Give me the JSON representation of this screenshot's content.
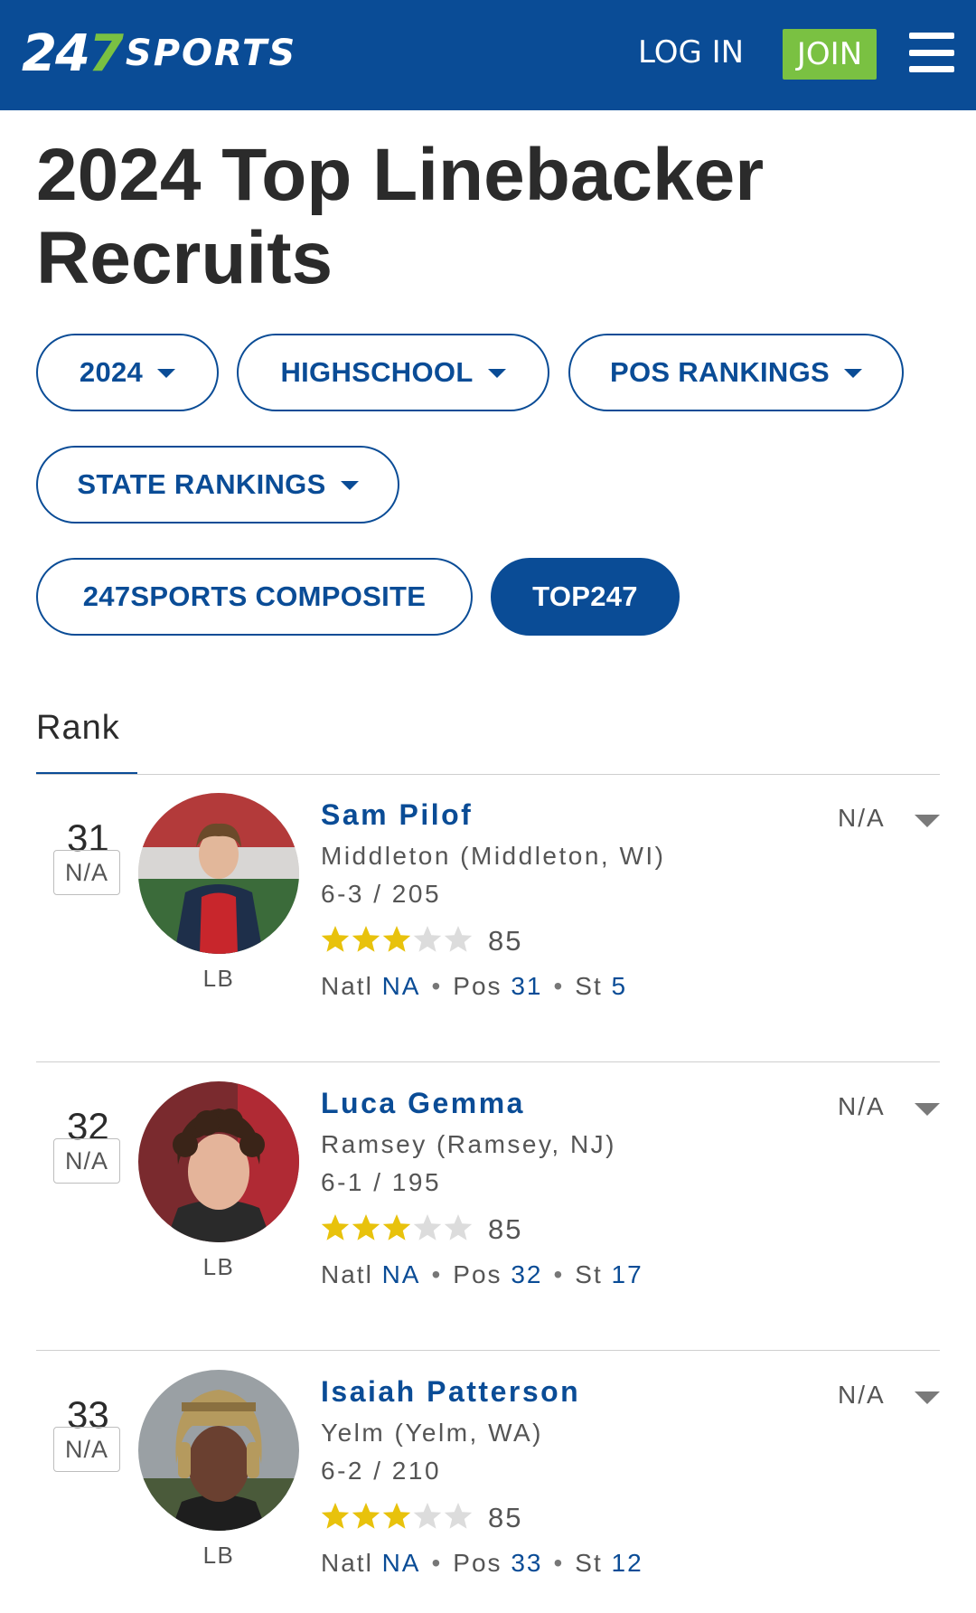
{
  "header": {
    "logo_num_a": "24",
    "logo_num_b": "7",
    "logo_word": "SPORTS",
    "login_label": "LOG IN",
    "join_label": "JOIN",
    "brand_color": "#0a4c96",
    "accent_color": "#7ac142"
  },
  "page": {
    "title": "2024 Top Linebacker Recruits"
  },
  "filters": {
    "year": "2024",
    "level": "HIGHSCHOOL",
    "pos_rankings": "POS RANKINGS",
    "state_rankings": "STATE RANKINGS",
    "composite": "247SPORTS COMPOSITE",
    "top247": "TOP247"
  },
  "table": {
    "rank_header": "Rank"
  },
  "players": [
    {
      "rank": "31",
      "rank_badge": "N/A",
      "position": "LB",
      "name": "Sam Pilof",
      "school": "Middleton (Middleton, WI)",
      "measurements": "6-3 / 205",
      "stars": 3,
      "rating": "85",
      "natl_label": "Natl",
      "natl": "NA",
      "pos_label": "Pos",
      "pos_rank": "31",
      "st_label": "St",
      "st_rank": "5",
      "status": "N/A"
    },
    {
      "rank": "32",
      "rank_badge": "N/A",
      "position": "LB",
      "name": "Luca Gemma",
      "school": "Ramsey (Ramsey, NJ)",
      "measurements": "6-1 / 195",
      "stars": 3,
      "rating": "85",
      "natl_label": "Natl",
      "natl": "NA",
      "pos_label": "Pos",
      "pos_rank": "32",
      "st_label": "St",
      "st_rank": "17",
      "status": "N/A"
    },
    {
      "rank": "33",
      "rank_badge": "N/A",
      "position": "LB",
      "name": "Isaiah Patterson",
      "school": "Yelm (Yelm, WA)",
      "measurements": "6-2 / 210",
      "stars": 3,
      "rating": "85",
      "natl_label": "Natl",
      "natl": "NA",
      "pos_label": "Pos",
      "pos_rank": "33",
      "st_label": "St",
      "st_rank": "12",
      "status": "N/A"
    }
  ]
}
